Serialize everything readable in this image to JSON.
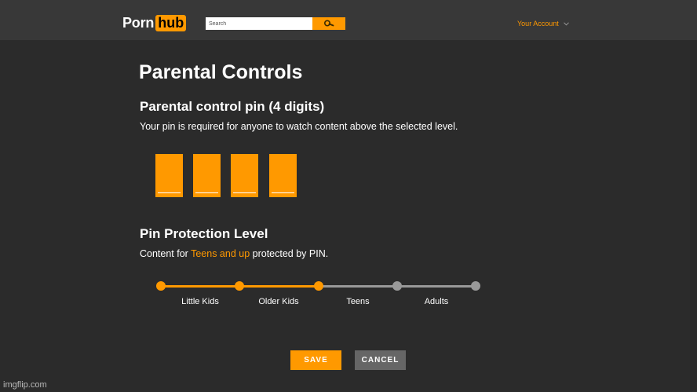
{
  "header": {
    "logo_part1": "Porn",
    "logo_part2": "hub",
    "search_placeholder": "Search",
    "account_label": "Your Account"
  },
  "page": {
    "title": "Parental Controls",
    "pin_heading": "Parental control pin (4 digits)",
    "pin_description": "Your pin is required for anyone to watch content above the selected level.",
    "pin_digits": [
      "",
      "",
      "",
      ""
    ],
    "level_heading": "Pin Protection Level",
    "level_text_before": "Content for ",
    "level_text_highlight": "Teens and up",
    "level_text_after": " protected by PIN."
  },
  "levels": {
    "labels": [
      "Little Kids",
      "Older Kids",
      "Teens",
      "Adults"
    ],
    "selected_index": 2
  },
  "actions": {
    "save_label": "SAVE",
    "cancel_label": "CANCEL"
  },
  "watermark": "imgflip.com",
  "colors": {
    "accent": "#ff9900",
    "background": "#2b2b2b",
    "topbar": "#383838",
    "track_inactive": "#999999",
    "cancel_bg": "#666666"
  }
}
